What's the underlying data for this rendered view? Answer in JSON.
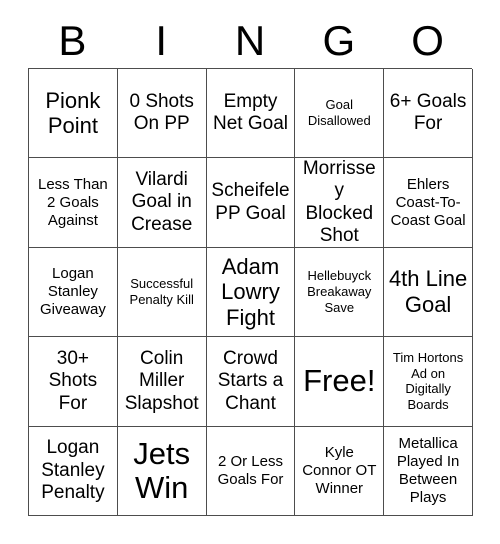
{
  "card": {
    "header_letters": [
      "B",
      "I",
      "N",
      "G",
      "O"
    ],
    "rows": [
      [
        {
          "text": "Pionk Point",
          "size": "lg"
        },
        {
          "text": "0 Shots On PP",
          "size": "md"
        },
        {
          "text": "Empty Net Goal",
          "size": "md"
        },
        {
          "text": "Goal Disallowed",
          "size": "xs"
        },
        {
          "text": "6+ Goals For",
          "size": "md"
        }
      ],
      [
        {
          "text": "Less Than 2 Goals Against",
          "size": "sm"
        },
        {
          "text": "Vilardi Goal in Crease",
          "size": "md"
        },
        {
          "text": "Scheifele PP Goal",
          "size": "md"
        },
        {
          "text": "Morrissey Blocked Shot",
          "size": "md"
        },
        {
          "text": "Ehlers Coast-To-Coast Goal",
          "size": "sm"
        }
      ],
      [
        {
          "text": "Logan Stanley Giveaway",
          "size": "sm"
        },
        {
          "text": "Successful Penalty Kill",
          "size": "xs"
        },
        {
          "text": "Adam Lowry Fight",
          "size": "lg"
        },
        {
          "text": "Hellebuyck Breakaway Save",
          "size": "xs"
        },
        {
          "text": "4th Line Goal",
          "size": "lg"
        }
      ],
      [
        {
          "text": "30+ Shots For",
          "size": "md"
        },
        {
          "text": "Colin Miller Slapshot",
          "size": "md"
        },
        {
          "text": "Crowd Starts a Chant",
          "size": "md"
        },
        {
          "text": "Free!",
          "size": "xl"
        },
        {
          "text": "Tim Hortons Ad on Digitally Boards",
          "size": "xs"
        }
      ],
      [
        {
          "text": "Logan Stanley Penalty",
          "size": "md"
        },
        {
          "text": "Jets Win",
          "size": "xl"
        },
        {
          "text": "2 Or Less Goals For",
          "size": "sm"
        },
        {
          "text": "Kyle Connor OT Winner",
          "size": "sm"
        },
        {
          "text": "Metallica Played In Between Plays",
          "size": "sm"
        }
      ]
    ]
  },
  "colors": {
    "border": "#4d4d4d",
    "text": "#000000",
    "background": "#ffffff"
  }
}
